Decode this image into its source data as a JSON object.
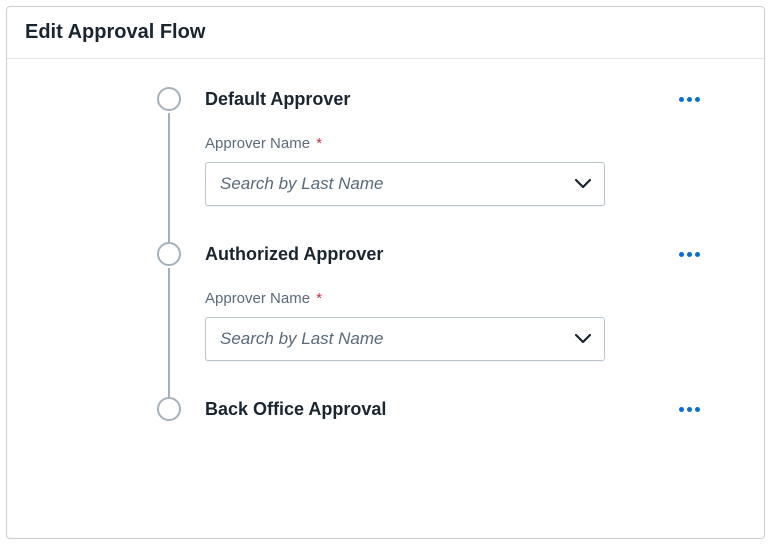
{
  "panel": {
    "title": "Edit Approval Flow"
  },
  "steps": [
    {
      "title": "Default Approver",
      "field_label": "Approver Name",
      "required_mark": "*",
      "placeholder": "Search by Last Name",
      "has_field": true
    },
    {
      "title": "Authorized Approver",
      "field_label": "Approver Name",
      "required_mark": "*",
      "placeholder": "Search by Last Name",
      "has_field": true
    },
    {
      "title": "Back Office Approval",
      "has_field": false
    }
  ]
}
